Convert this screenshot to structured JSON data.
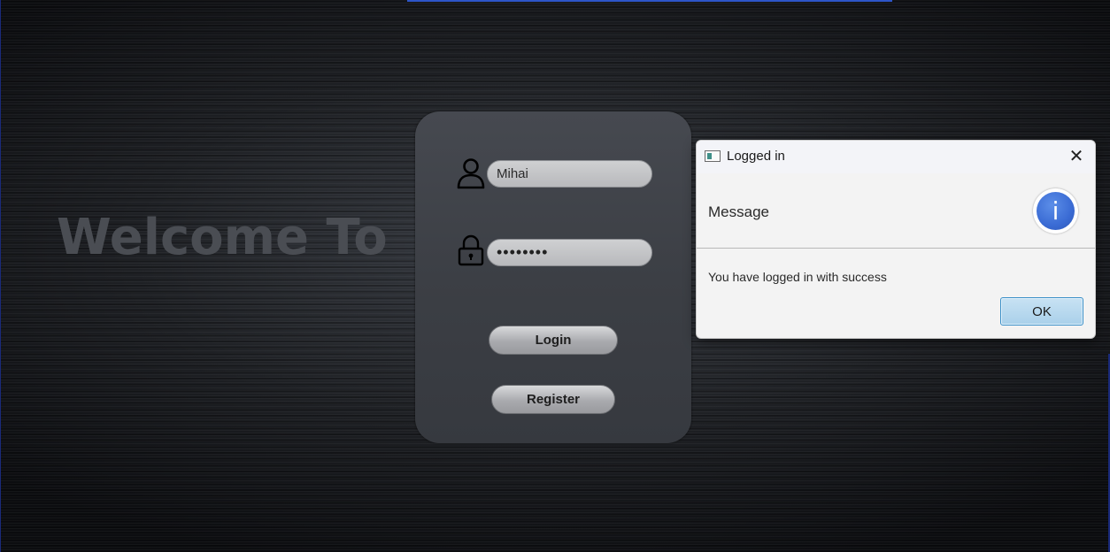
{
  "background": {
    "welcome_text": "Welcome To"
  },
  "login": {
    "username_value": "Mihai",
    "password_value": "••••••••",
    "login_label": "Login",
    "register_label": "Register"
  },
  "dialog": {
    "title": "Logged in",
    "close_glyph": "✕",
    "header_text": "Message",
    "info_glyph": "i",
    "body_text": "You have logged in with success",
    "ok_label": "OK"
  },
  "icons": {
    "username": "user-icon",
    "password": "lock-icon",
    "dialog_app": "window-app-icon",
    "dialog_close": "close-icon",
    "dialog_info": "info-icon"
  },
  "colors": {
    "welcome_text": "#4a4d53",
    "card_background": "#3f4248",
    "info_blue": "#3a6bd4",
    "ok_button": "#a9d0ea"
  }
}
